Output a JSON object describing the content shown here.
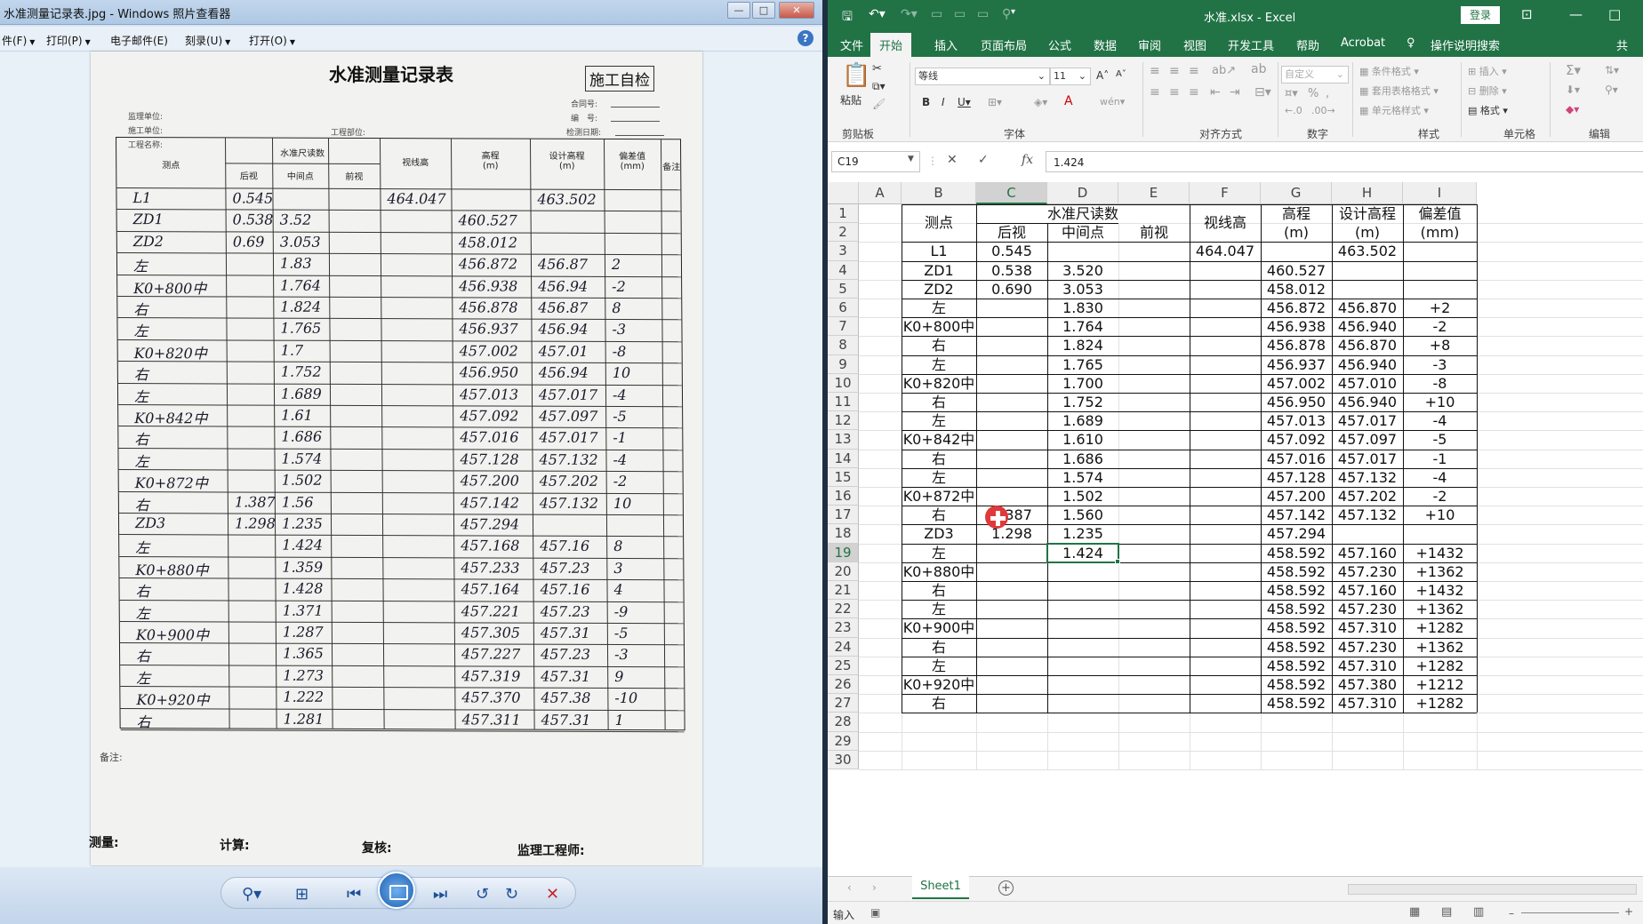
{
  "viewer": {
    "title": "水准测量记录表.jpg - Windows 照片查看器",
    "menu": [
      "件(F)",
      "打印(P)",
      "电子邮件(E)",
      "刻录(U)",
      "打开(O)"
    ],
    "photo": {
      "title": "水准测量记录表",
      "stamp": "施工自检",
      "meta_left": [
        "监理单位:",
        "施工单位:",
        "工程名称:"
      ],
      "meta_mid": "工程部位:",
      "meta_right": [
        "合同号:",
        "编　号:",
        "检测日期:"
      ],
      "headers": [
        "测点",
        "水准尺读数",
        "后视",
        "中间点",
        "前视",
        "视线高",
        "高程\n(m)",
        "设计高程\n(m)",
        "偏差值\n(mm)",
        "备注"
      ],
      "rows": [
        [
          "L1",
          "0.545",
          "",
          "464.047",
          "",
          "463.502",
          ""
        ],
        [
          "ZD1",
          "0.538",
          "3.52",
          "",
          "460.527",
          "",
          ""
        ],
        [
          "ZD2",
          "0.69",
          "3.053",
          "",
          "458.012",
          "",
          ""
        ],
        [
          "左",
          "",
          "1.83",
          "",
          "456.872",
          "456.87",
          "2"
        ],
        [
          "K0+800中",
          "",
          "1.764",
          "",
          "456.938",
          "456.94",
          "-2"
        ],
        [
          "右",
          "",
          "1.824",
          "",
          "456.878",
          "456.87",
          "8"
        ],
        [
          "左",
          "",
          "1.765",
          "",
          "456.937",
          "456.94",
          "-3"
        ],
        [
          "K0+820中",
          "",
          "1.7",
          "",
          "457.002",
          "457.01",
          "-8"
        ],
        [
          "右",
          "",
          "1.752",
          "",
          "456.950",
          "456.94",
          "10"
        ],
        [
          "左",
          "",
          "1.689",
          "",
          "457.013",
          "457.017",
          "-4"
        ],
        [
          "K0+842中",
          "",
          "1.61",
          "",
          "457.092",
          "457.097",
          "-5"
        ],
        [
          "右",
          "",
          "1.686",
          "",
          "457.016",
          "457.017",
          "-1"
        ],
        [
          "左",
          "",
          "1.574",
          "",
          "457.128",
          "457.132",
          "-4"
        ],
        [
          "K0+872中",
          "",
          "1.502",
          "",
          "457.200",
          "457.202",
          "-2"
        ],
        [
          "右",
          "1.387",
          "1.56",
          "",
          "457.142",
          "457.132",
          "10"
        ],
        [
          "ZD3",
          "1.298",
          "1.235",
          "",
          "457.294",
          "",
          ""
        ],
        [
          "左",
          "",
          "1.424",
          "",
          "457.168",
          "457.16",
          "8"
        ],
        [
          "K0+880中",
          "",
          "1.359",
          "",
          "457.233",
          "457.23",
          "3"
        ],
        [
          "右",
          "",
          "1.428",
          "",
          "457.164",
          "457.16",
          "4"
        ],
        [
          "左",
          "",
          "1.371",
          "",
          "457.221",
          "457.23",
          "-9"
        ],
        [
          "K0+900中",
          "",
          "1.287",
          "",
          "457.305",
          "457.31",
          "-5"
        ],
        [
          "右",
          "",
          "1.365",
          "",
          "457.227",
          "457.23",
          "-3"
        ],
        [
          "左",
          "",
          "1.273",
          "",
          "457.319",
          "457.31",
          "9"
        ],
        [
          "K0+920中",
          "",
          "1.222",
          "",
          "457.370",
          "457.38",
          "-10"
        ],
        [
          "右",
          "",
          "1.281",
          "",
          "457.311",
          "457.31",
          "1"
        ]
      ],
      "note": "备注:",
      "footer": [
        "测量:",
        "计算:",
        "复核:",
        "监理工程师:"
      ]
    }
  },
  "excel": {
    "file_title": "水准.xlsx - Excel",
    "login": "登录",
    "tabs": [
      "文件",
      "开始",
      "插入",
      "页面布局",
      "公式",
      "数据",
      "审阅",
      "视图",
      "开发工具",
      "帮助",
      "Acrobat",
      "操作说明搜索",
      "共"
    ],
    "active_tab": "开始",
    "ribbon": {
      "paste": "粘贴",
      "clipboard": "剪贴板",
      "font_name": "等线",
      "font_size": "11",
      "font_group": "字体",
      "align_group": "对齐方式",
      "number_format": "自定义",
      "number_group": "数字",
      "style_items": [
        "条件格式",
        "套用表格格式",
        "单元格样式"
      ],
      "style_group": "样式",
      "cell_items": [
        "插入",
        "删除",
        "格式"
      ],
      "cell_group": "单元格",
      "edit_group": "编辑"
    },
    "name_box": "C19",
    "formula": "1.424",
    "columns": [
      "A",
      "B",
      "C",
      "D",
      "E",
      "F",
      "G",
      "H",
      "I"
    ],
    "row_numbers": [
      "1",
      "2",
      "3",
      "4",
      "5",
      "6",
      "7",
      "8",
      "9",
      "10",
      "11",
      "12",
      "13",
      "14",
      "15",
      "16",
      "17",
      "18",
      "19",
      "20",
      "21",
      "22",
      "23",
      "24",
      "25",
      "26",
      "27",
      "28",
      "29",
      "30"
    ],
    "header": {
      "a": "测点",
      "bc": "水准尺读数",
      "b": "后视",
      "c": "中间点",
      "d": "前视",
      "e": "视线高",
      "f1": "高程",
      "f2": "(m)",
      "g1": "设计高程",
      "g2": "(m)",
      "h1": "偏差值",
      "h2": "(mm)"
    },
    "rows": [
      [
        "L1",
        "0.545",
        "",
        "",
        "464.047",
        "",
        "463.502",
        ""
      ],
      [
        "ZD1",
        "0.538",
        "3.520",
        "",
        "",
        "460.527",
        "",
        ""
      ],
      [
        "ZD2",
        "0.690",
        "3.053",
        "",
        "",
        "458.012",
        "",
        ""
      ],
      [
        "左",
        "",
        "1.830",
        "",
        "",
        "456.872",
        "456.870",
        "+2"
      ],
      [
        "K0+800中",
        "",
        "1.764",
        "",
        "",
        "456.938",
        "456.940",
        "-2"
      ],
      [
        "右",
        "",
        "1.824",
        "",
        "",
        "456.878",
        "456.870",
        "+8"
      ],
      [
        "左",
        "",
        "1.765",
        "",
        "",
        "456.937",
        "456.940",
        "-3"
      ],
      [
        "K0+820中",
        "",
        "1.700",
        "",
        "",
        "457.002",
        "457.010",
        "-8"
      ],
      [
        "右",
        "",
        "1.752",
        "",
        "",
        "456.950",
        "456.940",
        "+10"
      ],
      [
        "左",
        "",
        "1.689",
        "",
        "",
        "457.013",
        "457.017",
        "-4"
      ],
      [
        "K0+842中",
        "",
        "1.610",
        "",
        "",
        "457.092",
        "457.097",
        "-5"
      ],
      [
        "右",
        "",
        "1.686",
        "",
        "",
        "457.016",
        "457.017",
        "-1"
      ],
      [
        "左",
        "",
        "1.574",
        "",
        "",
        "457.128",
        "457.132",
        "-4"
      ],
      [
        "K0+872中",
        "",
        "1.502",
        "",
        "",
        "457.200",
        "457.202",
        "-2"
      ],
      [
        "右",
        "1.387",
        "1.560",
        "",
        "",
        "457.142",
        "457.132",
        "+10"
      ],
      [
        "ZD3",
        "1.298",
        "1.235",
        "",
        "",
        "457.294",
        "",
        ""
      ],
      [
        "左",
        "",
        "1.424",
        "",
        "",
        "458.592",
        "457.160",
        "+1432"
      ],
      [
        "K0+880中",
        "",
        "",
        "",
        "",
        "458.592",
        "457.230",
        "+1362"
      ],
      [
        "右",
        "",
        "",
        "",
        "",
        "458.592",
        "457.160",
        "+1432"
      ],
      [
        "左",
        "",
        "",
        "",
        "",
        "458.592",
        "457.230",
        "+1362"
      ],
      [
        "K0+900中",
        "",
        "",
        "",
        "",
        "458.592",
        "457.310",
        "+1282"
      ],
      [
        "右",
        "",
        "",
        "",
        "",
        "458.592",
        "457.230",
        "+1362"
      ],
      [
        "左",
        "",
        "",
        "",
        "",
        "458.592",
        "457.310",
        "+1282"
      ],
      [
        "K0+920中",
        "",
        "",
        "",
        "",
        "458.592",
        "457.380",
        "+1212"
      ],
      [
        "右",
        "",
        "",
        "",
        "",
        "458.592",
        "457.310",
        "+1282"
      ]
    ],
    "sheet_tab": "Sheet1",
    "status_mode": "输入"
  }
}
